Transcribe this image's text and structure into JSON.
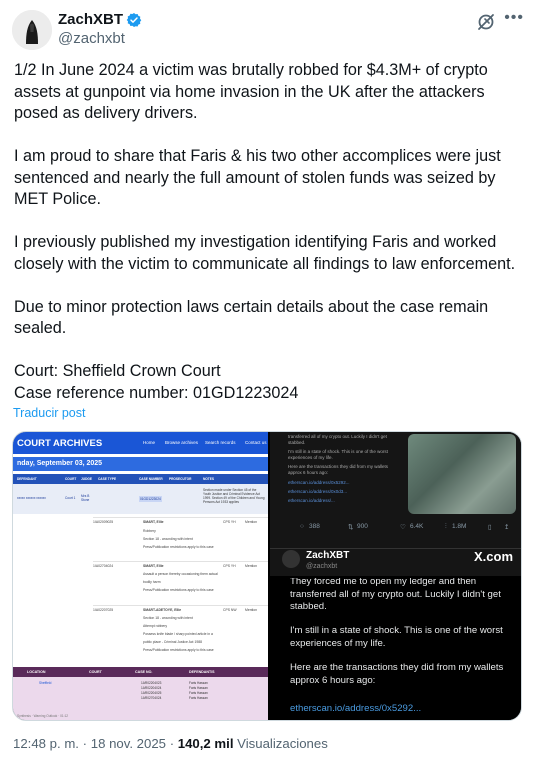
{
  "author": {
    "name": "ZachXBT",
    "handle": "@zachxbt"
  },
  "post": {
    "paragraphs": [
      "1/2 In June 2024 a victim was brutally robbed for $4.3M+ of crypto assets at gunpoint via home invasion in the UK after the attackers posed as delivery drivers.",
      "I am proud to share that Faris & his two other accomplices were just sentenced and nearly the full amount of stolen funds was seized by MET Police.",
      "I previously published my investigation identifying Faris and worked closely with the victim to communicate all findings to law enforcement.",
      "Due to minor protection laws certain details about the case remain sealed.",
      "Court: Sheffield Crown Court\nCase reference number: 01GD1223024"
    ],
    "translate_label": "Traducir post"
  },
  "media_left": {
    "title": "COURT ARCHIVES",
    "nav": [
      "Home",
      "Browse archives",
      "Search records",
      "Contact us"
    ],
    "date_bar": "nday, September 03, 2025",
    "table_headers": [
      "DEFENDANT",
      "COURT",
      "JUDGE",
      "CASE TYPE",
      "CASE NUMBER",
      "PROSECUTOR",
      "NOTES"
    ],
    "row": {
      "defendant": "xxxxx xxxxxx xxxxxx",
      "court": "Court 1",
      "judge": "Mrs B Stone",
      "case_number": "01GD1223024",
      "notes": "Section made under Section 45 of the Youth Justice and Criminal Evidence Act 1999. Section 49 of the Children and Young Persons Act 1933 applies"
    },
    "entries": [
      {
        "case": "1IA02009025",
        "name": "SMART, Ellie",
        "prosecutor": "CPS YH",
        "note": "Mention",
        "lines": [
          "Robbery",
          "Section 18 - wounding with intent",
          "Press/Publication restrictions apply to this case"
        ]
      },
      {
        "case": "1IA02704024",
        "name": "SMART, Ellie",
        "prosecutor": "CPS YH",
        "note": "Mention",
        "lines": [
          "Assault a person thereby occasioning them actual",
          "bodily harm",
          "Press/Publication restrictions apply to this case"
        ]
      },
      {
        "case": "1IA02207025",
        "name": "SMART-ADETOYE, Ellie",
        "prosecutor": "CPS NW",
        "note": "Mention",
        "lines": [
          "Section 18 - wounding with intent",
          "Attempt robbery",
          "Possess knife blade / sharp pointed article in a",
          "public place - Criminal Justice Act 1988",
          "Press/Publication restrictions apply to this case"
        ]
      }
    ],
    "footer_headers": [
      "LOCATION",
      "COURT",
      "CASE NO.",
      "DEFENDANT/S"
    ],
    "footer_location": "Sheffield",
    "footer_cases": [
      "1AR02204023",
      "1AR02204024",
      "1AR02204025",
      "1AR02704024"
    ],
    "footer_defendants": [
      "Faris Hassan",
      "Faris Hassan",
      "Faris Hassan",
      "Faris Hassan"
    ],
    "footer_note": "Synthesis · Warning Outlook · 01:12"
  },
  "media_top_right": {
    "lines": [
      "transferred all of my crypto out. Luckily I didn't get",
      "stabbed.",
      "I'm still in a state of shock. This is one of the worst",
      "experiences of my life.",
      "Here are the transactions they did from my wallets",
      "approx 6 hours ago:",
      "etherscan.io/address/0x5292...",
      "etherscan.io/address/0x0d3...",
      "etherscan.io/address/..."
    ],
    "stats": {
      "replies": "388",
      "reposts": "900",
      "likes": "6.4K",
      "views": "1.8M"
    },
    "card_name": "ZachXBT",
    "card_handle": "@zachxbt",
    "card_brand": "X.com"
  },
  "media_bottom_right": {
    "paragraphs": [
      "They forced me to open my ledger and then transferred all of my crypto out. Luckily I didn't get stabbed.",
      "I'm still in a state of shock. This is one of the worst experiences of my life.",
      "Here are the transactions they did from my wallets approx 6 hours ago:"
    ],
    "link": "etherscan.io/address/0x5292..."
  },
  "meta": {
    "time": "12:48 p. m.",
    "date": "18 nov. 2025",
    "views_count": "140,2 mil",
    "views_label": "Visualizaciones",
    "separator": "·"
  },
  "colors": {
    "verified": "#1d9bf0",
    "link": "#1d9bf0",
    "court_blue": "#1a56d6"
  }
}
